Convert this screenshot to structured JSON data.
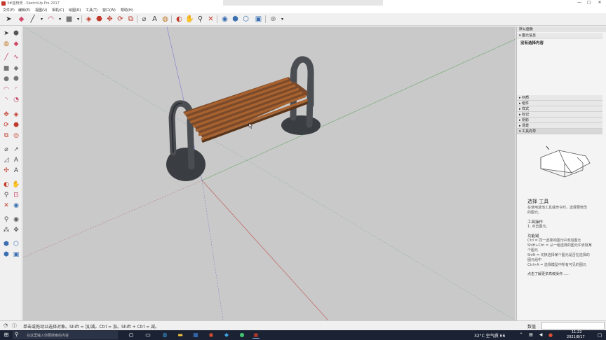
{
  "window": {
    "title": "3#座椅凳 - SketchUp Pro 2017",
    "controls": {
      "minimize": "—",
      "maximize": "□",
      "close": "✕"
    }
  },
  "menu": [
    "文件(F)",
    "编辑(E)",
    "视图(V)",
    "相机(C)",
    "绘图(R)",
    "工具(T)",
    "窗口(W)",
    "帮助(H)"
  ],
  "tray": {
    "title": "默认面板",
    "entity_info": {
      "header": "图元信息",
      "content": "没有选择内容"
    },
    "panels": [
      "材质",
      "组件",
      "样式",
      "标记",
      "阴影",
      "场景",
      "工具向导"
    ],
    "active_panel": "工具向导",
    "instructor": {
      "tool_title": "选择 工具",
      "desc_line1": "在使用其他工具或命令时，选择要修改",
      "desc_line2": "的图元。",
      "ops_title": "工具操作",
      "op1": "1. 点击图元。",
      "mods_title": "功能键",
      "mod1": "Ctrl = 同一选择的图元中添加图元",
      "mod2": "Shift+Ctrl = 从一组选择的图元中去除某",
      "mod2b": "个图元",
      "mod3": "Shift = 切换选择某个图元是否在选择的",
      "mod3b": "图元组中",
      "mod4": "Ctrl+A = 选择模型中所有可见的图元",
      "more_link": "点击了解更多高级操作……"
    }
  },
  "status": {
    "message": "单击或拖动以选择对象。Shift = 加/减。Ctrl = 加。Shift + Ctrl = 减。",
    "measure_label": "数值"
  },
  "taskbar": {
    "search_placeholder": "在这里输入你要搜索的内容",
    "weather": "32°C 空气质 66",
    "time": "11:22",
    "date": "2021/8/17"
  }
}
